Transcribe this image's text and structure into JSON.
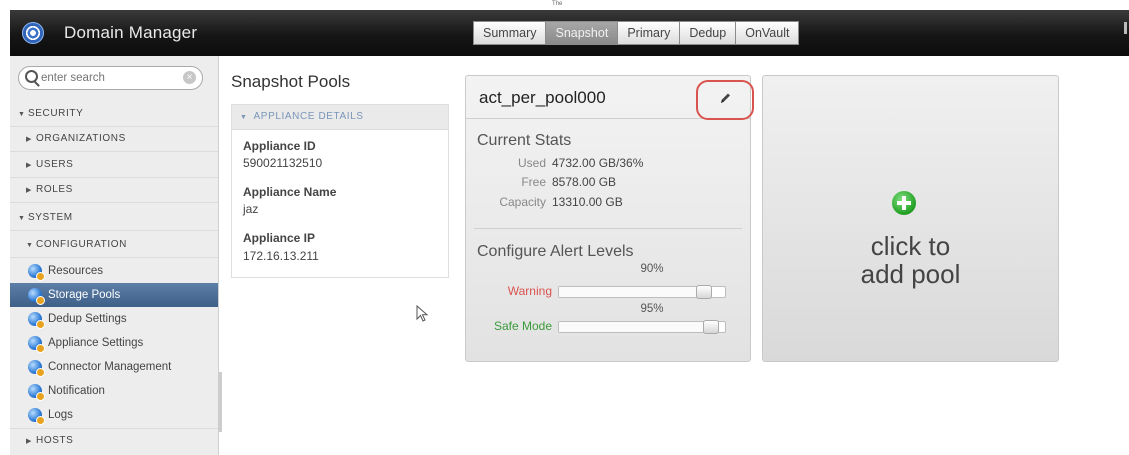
{
  "top_note": "The",
  "header": {
    "app_title": "Domain Manager",
    "tabs": [
      {
        "label": "Summary",
        "active": false
      },
      {
        "label": "Snapshot",
        "active": true
      },
      {
        "label": "Primary",
        "active": false
      },
      {
        "label": "Dedup",
        "active": false
      },
      {
        "label": "OnVault",
        "active": false
      }
    ]
  },
  "sidebar": {
    "search_placeholder": "enter search",
    "security": "SECURITY",
    "organizations": "ORGANIZATIONS",
    "users": "USERS",
    "roles": "ROLES",
    "system": "SYSTEM",
    "configuration": "CONFIGURATION",
    "items": [
      {
        "label": "Resources",
        "selected": false
      },
      {
        "label": "Storage Pools",
        "selected": true
      },
      {
        "label": "Dedup Settings",
        "selected": false
      },
      {
        "label": "Appliance Settings",
        "selected": false
      },
      {
        "label": "Connector Management",
        "selected": false
      },
      {
        "label": "Notification",
        "selected": false
      },
      {
        "label": "Logs",
        "selected": false
      }
    ],
    "hosts": "HOSTS"
  },
  "main": {
    "title": "Snapshot Pools",
    "details_header": "APPLIANCE DETAILS",
    "appliance_id_label": "Appliance ID",
    "appliance_id": "590021132510",
    "appliance_name_label": "Appliance Name",
    "appliance_name": "jaz",
    "appliance_ip_label": "Appliance IP",
    "appliance_ip": "172.16.13.211"
  },
  "pool": {
    "name": "act_per_pool000",
    "stats_title": "Current Stats",
    "used_label": "Used",
    "used_value": "4732.00 GB/36%",
    "free_label": "Free",
    "free_value": "8578.00 GB",
    "capacity_label": "Capacity",
    "capacity_value": "13310.00 GB",
    "alert_title": "Configure Alert Levels",
    "warning_label": "Warning",
    "warning_pct": "90%",
    "warning_level": 0.9,
    "safe_label": "Safe Mode",
    "safe_pct": "95%",
    "safe_level": 0.95
  },
  "add_pool": {
    "line1": "click to",
    "line2": "add pool"
  },
  "colors": {
    "warning": "#d9534f",
    "safe_mode": "#3a9a3a",
    "selected_item": "#4a6b93",
    "edit_highlight": "#d9534f"
  },
  "icons": {
    "logo": "domain-manager-logo-icon",
    "search": "search-icon",
    "clear": "clear-icon",
    "edit": "pencil-icon",
    "add": "plus-circle-icon",
    "nav_item": "globe-gear-icon",
    "cursor": "mouse-cursor-icon"
  }
}
